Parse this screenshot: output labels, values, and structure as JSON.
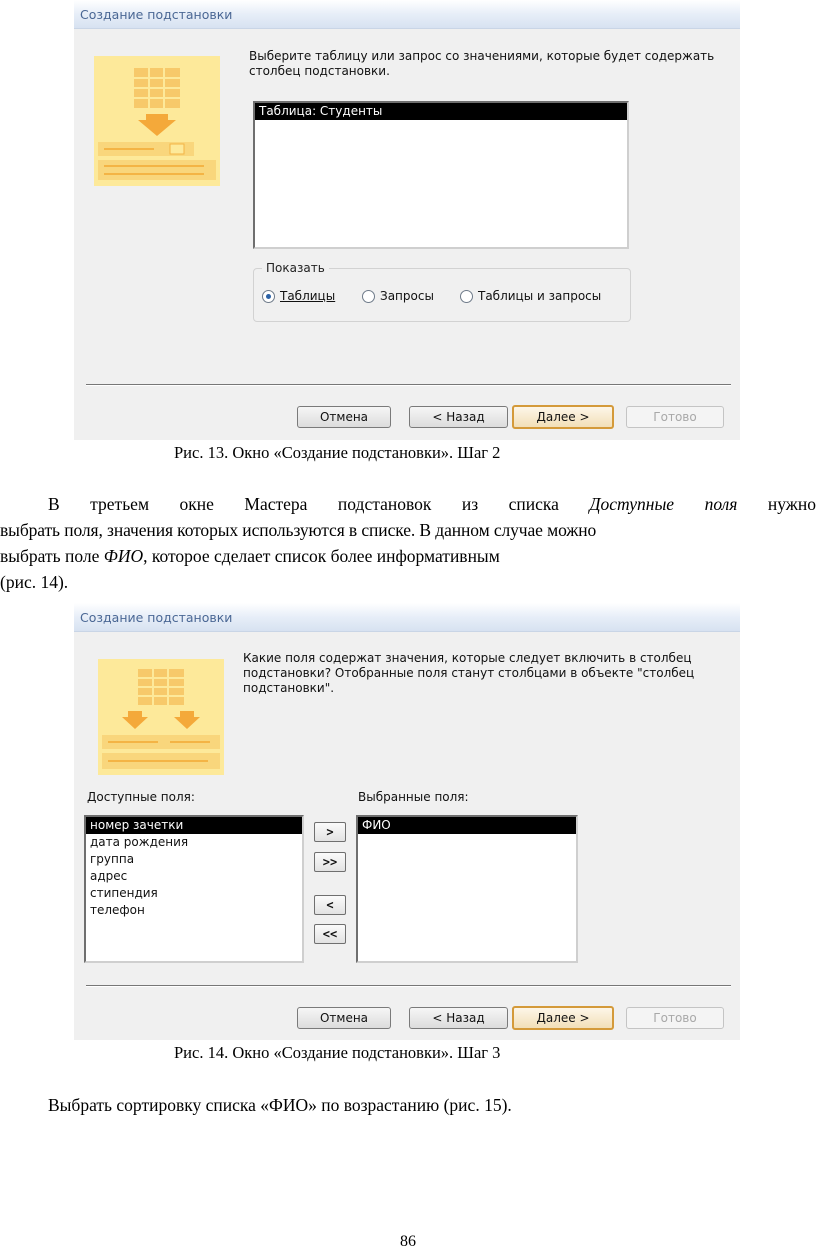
{
  "fig13": {
    "title": "Создание подстановки",
    "prompt_line1": "Выберите таблицу или запрос со значениями, которые будет содержать",
    "prompt_line2": "столбец подстановки.",
    "list_items": [
      "Таблица: Студенты"
    ],
    "group_label": "Показать",
    "radio_tables": "Таблицы",
    "radio_queries": "Запросы",
    "radio_both": "Таблицы и запросы",
    "selected_radio": "Таблицы",
    "btn_cancel": "Отмена",
    "btn_back": "< Назад",
    "btn_next": "Далее >",
    "btn_finish": "Готово",
    "caption": "Рис. 13. Окно «Создание подстановки». Шаг 2"
  },
  "paragraph": {
    "line1_a": "В третьем окне Мастера подстановок из списка",
    "line1_italic": "Доступные поля",
    "line1_b": "нужно",
    "line2": "выбрать поля, значения которых используются в списке. В данном случае можно",
    "line3_a": "выбрать поле",
    "line3_italic": "ФИО",
    "line3_b": ", которое сделает список более информативным",
    "line4": "(рис. 14)."
  },
  "fig14": {
    "title": "Создание подстановки",
    "prompt_line1": "Какие поля содержат значения, которые следует включить в столбец",
    "prompt_line2": "подстановки? Отобранные поля станут столбцами в объекте \"столбец",
    "prompt_line3": "подстановки\".",
    "available_label": "Доступные поля:",
    "selected_label": "Выбранные поля:",
    "available_fields": [
      "номер зачетки",
      "дата рождения",
      "группа",
      "адрес",
      "стипендия",
      "телефон"
    ],
    "selected_fields": [
      "ФИО"
    ],
    "move_one": ">",
    "move_all": ">>",
    "remove_one": "<",
    "remove_all": "<<",
    "btn_cancel": "Отмена",
    "btn_back": "< Назад",
    "btn_next": "Далее >",
    "btn_finish": "Готово",
    "caption": "Рис. 14. Окно «Создание подстановки». Шаг 3"
  },
  "closing": "Выбрать сортировку списка «ФИО» по возрастанию (рис. 15).",
  "page_number": "86",
  "colors": {
    "title_text": "#4a6794",
    "wizard_yellow": "#fde99a",
    "wizard_orange": "#f4b445",
    "default_button_border": "#d49a3a"
  }
}
